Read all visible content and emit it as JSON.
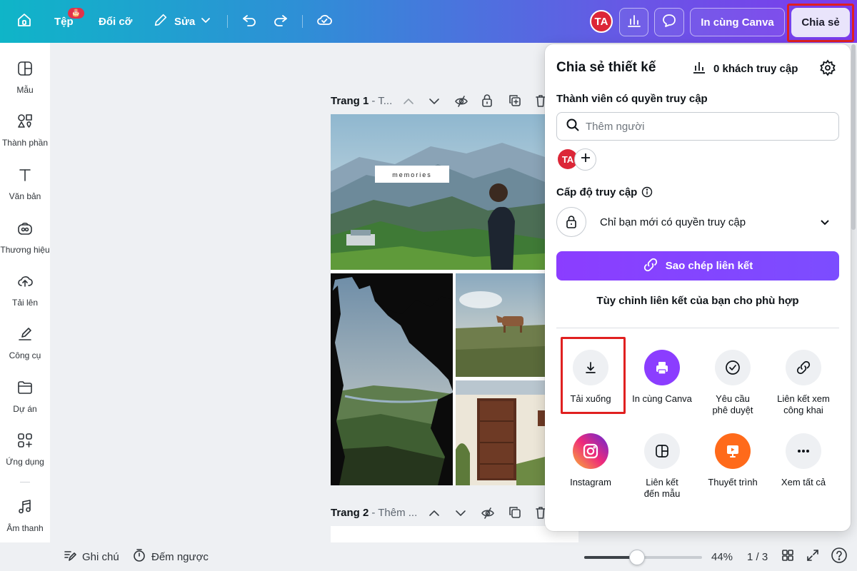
{
  "topbar": {
    "file_label": "Tệp",
    "file_badge": "🎂",
    "resize_label": "Đổi cỡ",
    "edit_label": "Sửa",
    "avatar": "TA",
    "print_label": "In cùng Canva",
    "share_label": "Chia sẻ"
  },
  "sidebar": {
    "items": [
      {
        "label": "Mẫu",
        "icon": "template-icon"
      },
      {
        "label": "Thành phần",
        "icon": "elements-icon"
      },
      {
        "label": "Văn bản",
        "icon": "text-icon"
      },
      {
        "label": "Thương hiệu",
        "icon": "brand-icon"
      },
      {
        "label": "Tải lên",
        "icon": "upload-icon"
      },
      {
        "label": "Công cụ",
        "icon": "draw-icon"
      },
      {
        "label": "Dự án",
        "icon": "folder-icon"
      },
      {
        "label": "Ứng dụng",
        "icon": "apps-icon"
      },
      {
        "label": "Âm thanh",
        "icon": "music-icon"
      }
    ]
  },
  "canvas": {
    "page1_title": "Trang 1",
    "page1_sub": "- T...",
    "page2_title": "Trang 2",
    "page2_sub": "- Thêm ...",
    "memories_text": "memories"
  },
  "bottombar": {
    "notes_label": "Ghi chú",
    "timer_label": "Đếm ngược",
    "zoom": "44%",
    "zoom_fraction": 0.44,
    "pages": "1 / 3"
  },
  "share_panel": {
    "title": "Chia sẻ thiết kế",
    "visitors": "0 khách truy cập",
    "members_label": "Thành viên có quyền truy cập",
    "search_placeholder": "Thêm người",
    "member_avatar": "TA",
    "access_level_label": "Cấp độ truy cập",
    "access_value": "Chỉ bạn mới có quyền truy cập",
    "copy_link": "Sao chép liên kết",
    "customize_link": "Tùy chỉnh liên kết của bạn cho phù hợp",
    "options": [
      {
        "label": "Tải xuống",
        "icon": "download-icon"
      },
      {
        "label": "In cùng Canva",
        "icon": "printer-icon"
      },
      {
        "label": "Yêu cầu phê duyệt",
        "icon": "check-circle-icon"
      },
      {
        "label": "Liên kết xem công khai",
        "icon": "link-icon"
      },
      {
        "label": "Instagram",
        "icon": "instagram-icon"
      },
      {
        "label": "Liên kết đến mẫu",
        "icon": "template-link-icon"
      },
      {
        "label": "Thuyết trình",
        "icon": "present-icon"
      },
      {
        "label": "Xem tất cả",
        "icon": "more-icon"
      }
    ]
  },
  "colors": {
    "accent_purple": "#8b3dff",
    "highlight_red": "#e02020",
    "avatar_red": "#dc2637"
  }
}
